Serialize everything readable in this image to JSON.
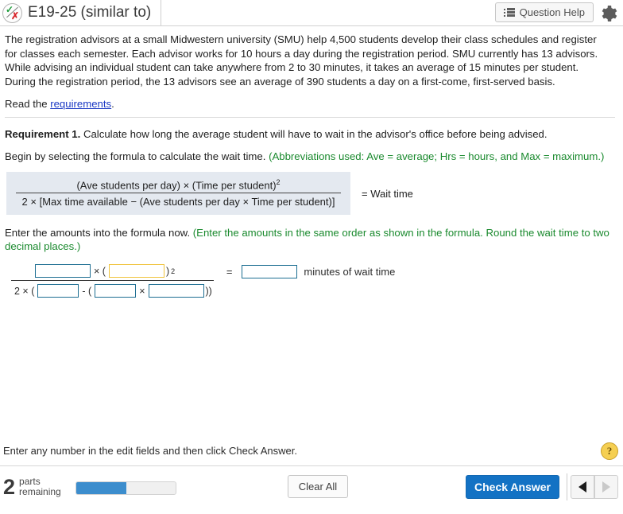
{
  "header": {
    "title": "E19-25 (similar to)",
    "status_icon": "check-x-circle-icon",
    "question_help_label": "Question Help",
    "question_help_icon": "list-icon",
    "settings_icon": "gear-icon"
  },
  "problem": {
    "paragraph": "The registration advisors at a small Midwestern university (SMU) help 4,500 students develop their class schedules and register for classes each semester. Each advisor works for 10 hours a day during the registration period. SMU currently has 13 advisors. While advising an individual student can take anywhere from 2 to 30 minutes, it takes an average of 15 minutes per student. During the registration period, the 13 advisors see an average of 390 students a day on a first-come, first-served basis.",
    "read_prefix": "Read the ",
    "read_link": "requirements",
    "read_suffix": "."
  },
  "requirement": {
    "label": "Requirement 1.",
    "text": " Calculate how long the average student will have to wait in the advisor's office before being advised.",
    "begin_text": "Begin by selecting the formula to calculate the wait time. ",
    "begin_note": "(Abbreviations used: Ave = average; Hrs = hours, and Max = maximum.)"
  },
  "formula": {
    "numerator_pre": "(Ave students per day)  ×  (Time per student)",
    "numerator_exp": "2",
    "denominator": "2  ×  [Max time available  −  (Ave students per day  ×  Time per student)]",
    "equals_label": "= Wait time"
  },
  "enter_amounts": {
    "text": "Enter the amounts into the formula now. ",
    "note": "(Enter the amounts in the same order as shown in the formula. Round the wait time to two decimal places.)"
  },
  "answer_formula": {
    "num_field_1": "",
    "num_op": "× (",
    "num_field_2": "",
    "num_close": ")",
    "num_exponent": "2",
    "den_prefix": "2 × (",
    "den_field_1": "",
    "den_op_minus": "- (",
    "den_field_2": "",
    "den_op_times": "×",
    "den_field_3": "",
    "den_close": "))",
    "equals_sign": "=",
    "result_field": "",
    "result_label": "minutes of wait time",
    "focused_field": "num_field_2",
    "field_border_color": "#1d6e92",
    "focused_border_color": "#f0c33c"
  },
  "footer": {
    "note": "Enter any number in the edit fields and then click Check Answer.",
    "help_badge": "?",
    "parts_count": "2",
    "parts_line1": "parts",
    "parts_line2": "remaining",
    "progress_percent": 50,
    "progress_color": "#3c8dcd",
    "clear_all_label": "Clear All",
    "check_answer_label": "Check Answer",
    "prev_icon": "triangle-left-icon",
    "next_icon": "triangle-right-icon"
  }
}
